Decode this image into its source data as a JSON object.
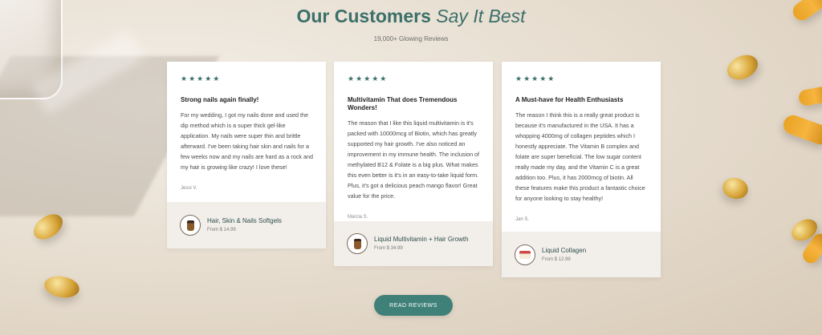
{
  "header": {
    "title_main": "Our Customers",
    "title_italic": "Say It Best",
    "subtitle": "19,000+ Glowing Reviews"
  },
  "reviews": [
    {
      "stars": "★★★★★",
      "rating": 5,
      "title": "Strong nails again finally!",
      "text": "For my wedding, I got my nails done and used the dip method which is a super thick gel-like application. My nails were super thin and brittle afterward. I've been taking hair skin and nails for a few weeks now and my nails are hard as a rock and my hair is growing like crazy! I love these!",
      "reviewer": "Jessi V.",
      "product_name": "Hair, Skin & Nails Softgels",
      "product_price": "From $ 14.99"
    },
    {
      "stars": "★★★★★",
      "rating": 5,
      "title": "Multivitamin That does Tremendous Wonders!",
      "text": "The reason that I like this liquid multivitamin is it's packed with 10000mcg of Biotin, which has greatly supported my hair growth. I've also noticed an improvement in my immune health. The inclusion of methylated B12 & Folate is a big plus. What makes this even better is it's in an easy-to-take liquid form. Plus, it's got a delicious peach mango flavor! Great value for the price.",
      "reviewer": "Marcia S.",
      "product_name": "Liquid Multivitamin + Hair Growth",
      "product_price": "From $ 34.99"
    },
    {
      "stars": "★★★★★",
      "rating": 5,
      "title": "A Must-have for Health Enthusiasts",
      "text": "The reason I think this is a really great product is because it's manufactured in the USA. It has a whopping 4000mg of collagen peptides which I honestly appreciate. The Vitamin B complex and folate are super beneficial. The low sugar content really made my day, and the Vitamin C is a great addition too. Plus, it has 2000mcg of biotin. All these features make this product a fantastic choice for anyone looking to stay healthy!",
      "reviewer": "Jan S.",
      "product_name": "Liquid Collagen",
      "product_price": "From $ 12.99"
    }
  ],
  "cta": {
    "label": "READ REVIEWS"
  },
  "colors": {
    "accent": "#3b6f69",
    "button": "#3f8178",
    "card_footer": "#f2efeb"
  }
}
